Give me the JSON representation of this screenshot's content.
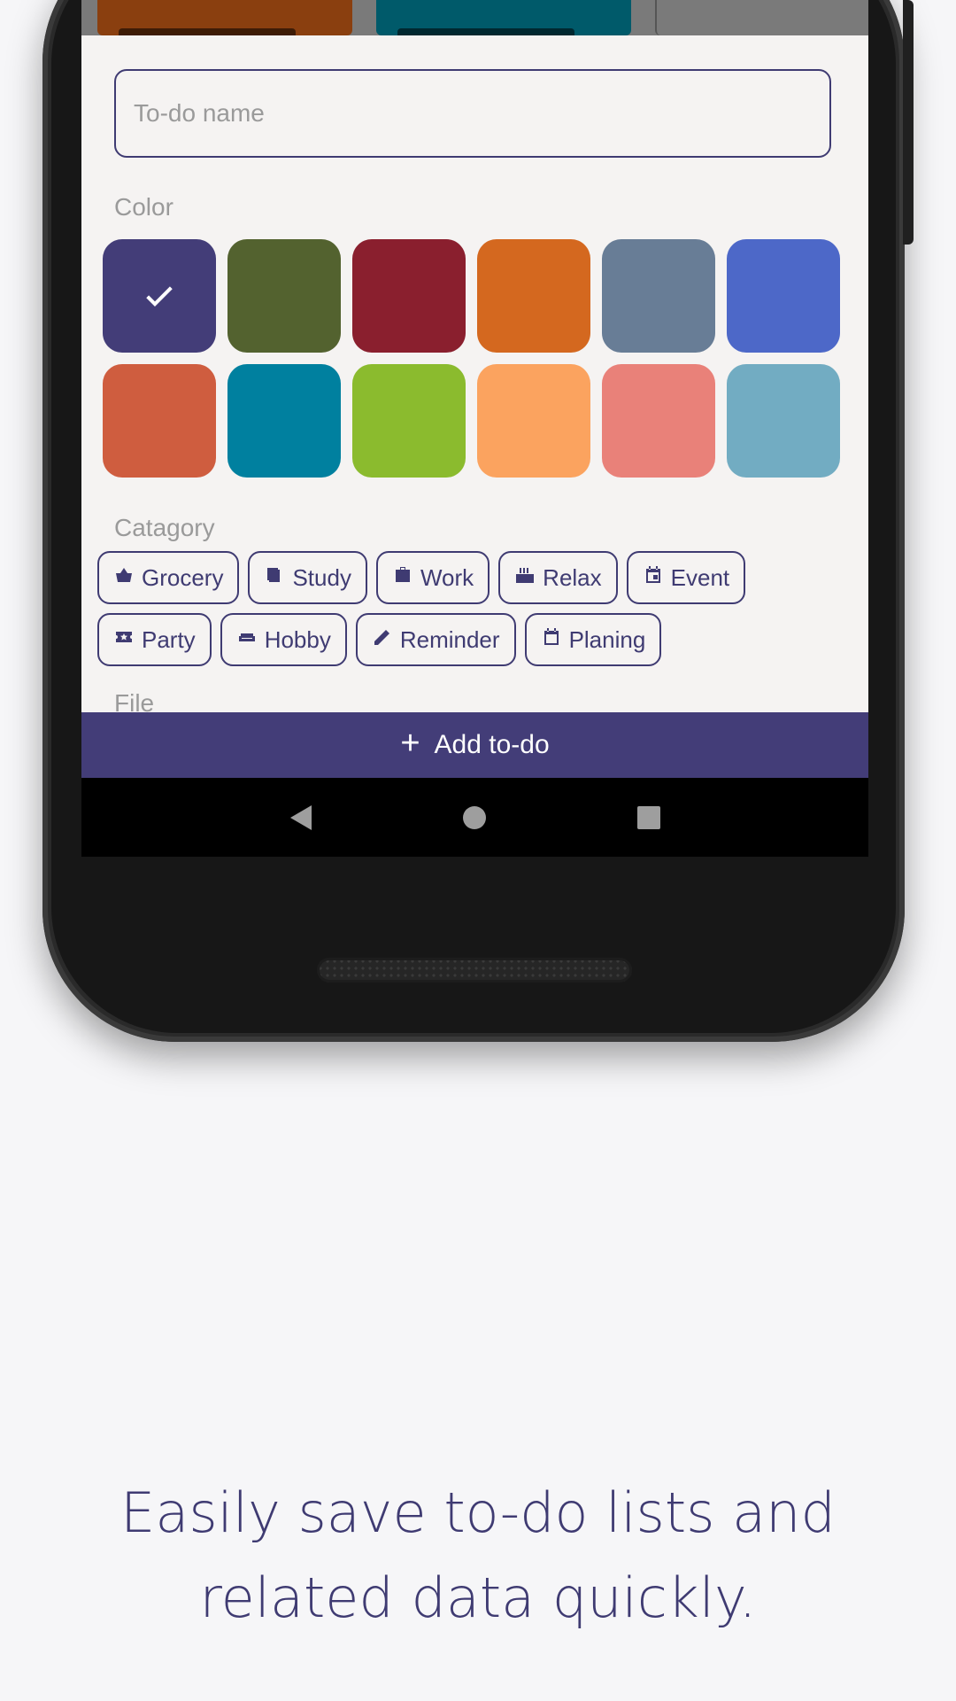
{
  "form": {
    "name_placeholder": "To-do name",
    "color_label": "Color",
    "category_label": "Catagory",
    "file_label": "File",
    "selected_color_index": 0,
    "colors": [
      "#433d78",
      "#53622f",
      "#8a1f2e",
      "#d4681f",
      "#687d96",
      "#4d68c8",
      "#cf5d3f",
      "#00809f",
      "#8bbb2e",
      "#fba35f",
      "#e98179",
      "#72acc2"
    ],
    "categories": [
      {
        "label": "Grocery",
        "icon": "basket-icon"
      },
      {
        "label": "Study",
        "icon": "book-icon"
      },
      {
        "label": "Work",
        "icon": "briefcase-icon"
      },
      {
        "label": "Relax",
        "icon": "hot-tub-icon"
      },
      {
        "label": "Event",
        "icon": "calendar-event-icon"
      },
      {
        "label": "Party",
        "icon": "ticket-icon"
      },
      {
        "label": "Hobby",
        "icon": "couch-icon"
      },
      {
        "label": "Reminder",
        "icon": "pencil-icon"
      },
      {
        "label": "Planing",
        "icon": "calendar-icon"
      }
    ]
  },
  "actions": {
    "add_label": "Add to-do"
  },
  "background_cards": [
    "#8a3f0f",
    "#005a6a"
  ],
  "tagline": {
    "line1": "Easily save to-do lists and",
    "line2": "related data quickly."
  },
  "colors": {
    "primary": "#433d78",
    "sheet_bg": "#f5f3f2",
    "page_bg": "#f6f6f8"
  }
}
